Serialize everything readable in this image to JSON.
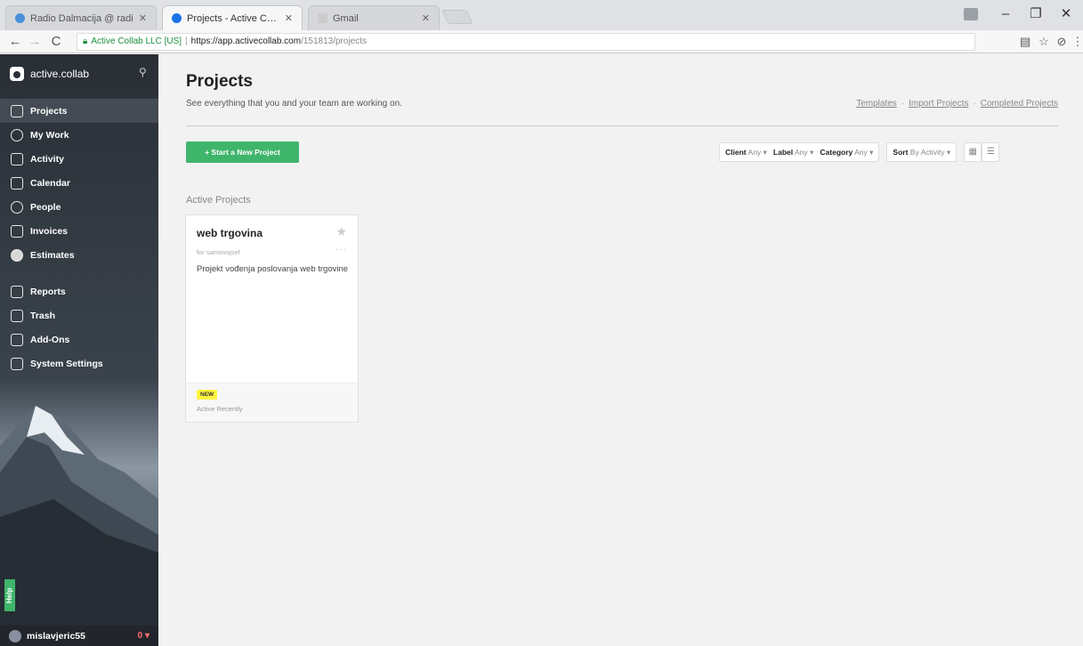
{
  "browser": {
    "tabs": [
      {
        "title": "Radio Dalmacija @ radi",
        "favicon_color": "#4a90d9",
        "active": false
      },
      {
        "title": "Projects - Active Collab",
        "favicon_color": "#1a73e8",
        "active": true
      },
      {
        "title": "Gmail",
        "favicon_color": "#cccccc",
        "active": false
      }
    ],
    "url": {
      "org": "Active Collab LLC [US]",
      "host": "https://app.activecollab.com",
      "path": "/151813/projects"
    },
    "window": {
      "minimize": "–",
      "maximize": "❐",
      "close": "✕"
    }
  },
  "sidebar": {
    "brand": "active.collab",
    "items": [
      {
        "label": "Projects",
        "icon": "projects-icon",
        "active": true
      },
      {
        "label": "My Work",
        "icon": "my-work-icon",
        "active": false
      },
      {
        "label": "Activity",
        "icon": "activity-icon",
        "active": false
      },
      {
        "label": "Calendar",
        "icon": "calendar-icon",
        "active": false
      },
      {
        "label": "People",
        "icon": "people-icon",
        "active": false
      },
      {
        "label": "Invoices",
        "icon": "invoices-icon",
        "active": false
      },
      {
        "label": "Estimates",
        "icon": "estimates-icon",
        "active": false
      }
    ],
    "items2": [
      {
        "label": "Reports",
        "icon": "reports-icon"
      },
      {
        "label": "Trash",
        "icon": "trash-icon"
      },
      {
        "label": "Add-Ons",
        "icon": "add-ons-icon"
      },
      {
        "label": "System Settings",
        "icon": "system-settings-icon"
      }
    ],
    "help": "Help",
    "user": "mislavjeric55",
    "user_badge": "0 ▾"
  },
  "main": {
    "title": "Projects",
    "subtitle": "See everything that you and your team are working on.",
    "links": [
      "Templates",
      "Import Projects",
      "Completed Projects"
    ],
    "new_project_label": "+ Start a New Project",
    "filters": [
      {
        "label": "Client",
        "value": "Any ▾"
      },
      {
        "label": "Label",
        "value": "Any ▾"
      },
      {
        "label": "Category",
        "value": "Any ▾"
      }
    ],
    "sort": {
      "label": "Sort",
      "value": "By Activity ▾"
    },
    "section": "Active Projects",
    "project": {
      "name": "web trgovina",
      "client": "for samovojsef",
      "description": "Projekt vođenja poslovanja web trgovine",
      "tag": "NEW",
      "status": "Active Recently"
    }
  },
  "colors": {
    "accent": "#3fb56b",
    "sidebar_bg": "#2a2f36",
    "new_tag": "#fff53d"
  }
}
